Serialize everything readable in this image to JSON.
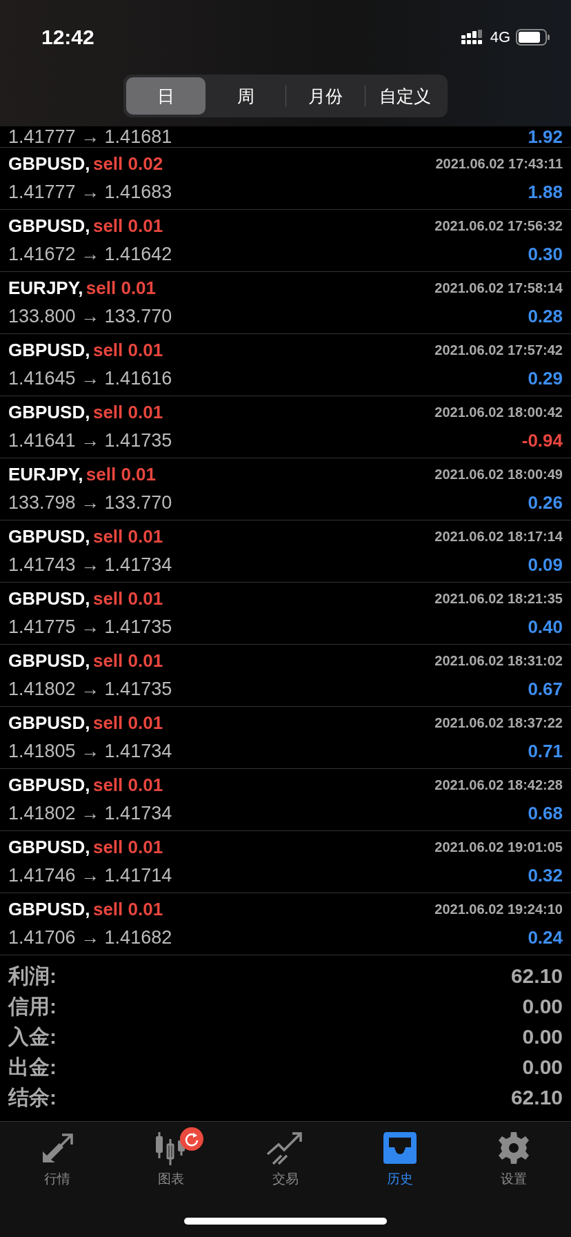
{
  "status_bar": {
    "time": "12:42",
    "network": "4G"
  },
  "period_tabs": [
    {
      "label": "日",
      "selected": true
    },
    {
      "label": "周",
      "selected": false
    },
    {
      "label": "月份",
      "selected": false
    },
    {
      "label": "自定义",
      "selected": false
    }
  ],
  "partial_row": {
    "prices": "1.41777 → 1.41681",
    "profit": "1.92",
    "loss": false
  },
  "deals": [
    {
      "symbol": "GBPUSD,",
      "action": "sell 0.02",
      "time": "2021.06.02 17:43:11",
      "prices": "1.41777 → 1.41683",
      "profit": "1.88",
      "loss": false
    },
    {
      "symbol": "GBPUSD,",
      "action": "sell 0.01",
      "time": "2021.06.02 17:56:32",
      "prices": "1.41672 → 1.41642",
      "profit": "0.30",
      "loss": false
    },
    {
      "symbol": "EURJPY,",
      "action": "sell 0.01",
      "time": "2021.06.02 17:58:14",
      "prices": "133.800 → 133.770",
      "profit": "0.28",
      "loss": false
    },
    {
      "symbol": "GBPUSD,",
      "action": "sell 0.01",
      "time": "2021.06.02 17:57:42",
      "prices": "1.41645 → 1.41616",
      "profit": "0.29",
      "loss": false
    },
    {
      "symbol": "GBPUSD,",
      "action": "sell 0.01",
      "time": "2021.06.02 18:00:42",
      "prices": "1.41641 → 1.41735",
      "profit": "-0.94",
      "loss": true
    },
    {
      "symbol": "EURJPY,",
      "action": "sell 0.01",
      "time": "2021.06.02 18:00:49",
      "prices": "133.798 → 133.770",
      "profit": "0.26",
      "loss": false
    },
    {
      "symbol": "GBPUSD,",
      "action": "sell 0.01",
      "time": "2021.06.02 18:17:14",
      "prices": "1.41743 → 1.41734",
      "profit": "0.09",
      "loss": false
    },
    {
      "symbol": "GBPUSD,",
      "action": "sell 0.01",
      "time": "2021.06.02 18:21:35",
      "prices": "1.41775 → 1.41735",
      "profit": "0.40",
      "loss": false
    },
    {
      "symbol": "GBPUSD,",
      "action": "sell 0.01",
      "time": "2021.06.02 18:31:02",
      "prices": "1.41802 → 1.41735",
      "profit": "0.67",
      "loss": false
    },
    {
      "symbol": "GBPUSD,",
      "action": "sell 0.01",
      "time": "2021.06.02 18:37:22",
      "prices": "1.41805 → 1.41734",
      "profit": "0.71",
      "loss": false
    },
    {
      "symbol": "GBPUSD,",
      "action": "sell 0.01",
      "time": "2021.06.02 18:42:28",
      "prices": "1.41802 → 1.41734",
      "profit": "0.68",
      "loss": false
    },
    {
      "symbol": "GBPUSD,",
      "action": "sell 0.01",
      "time": "2021.06.02 19:01:05",
      "prices": "1.41746 → 1.41714",
      "profit": "0.32",
      "loss": false
    },
    {
      "symbol": "GBPUSD,",
      "action": "sell 0.01",
      "time": "2021.06.02 19:24:10",
      "prices": "1.41706 → 1.41682",
      "profit": "0.24",
      "loss": false
    }
  ],
  "summary": [
    {
      "label": "利润:",
      "value": "62.10"
    },
    {
      "label": "信用:",
      "value": "0.00"
    },
    {
      "label": "入金:",
      "value": "0.00"
    },
    {
      "label": "出金:",
      "value": "0.00"
    },
    {
      "label": "结余:",
      "value": "62.10"
    }
  ],
  "bottom_tabs": [
    {
      "kind": "quotes",
      "label": "行情",
      "selected": false,
      "badge": false
    },
    {
      "kind": "chart",
      "label": "图表",
      "selected": false,
      "badge": true
    },
    {
      "kind": "trade",
      "label": "交易",
      "selected": false,
      "badge": false
    },
    {
      "kind": "history",
      "label": "历史",
      "selected": true,
      "badge": false
    },
    {
      "kind": "settings",
      "label": "设置",
      "selected": false,
      "badge": false
    }
  ]
}
